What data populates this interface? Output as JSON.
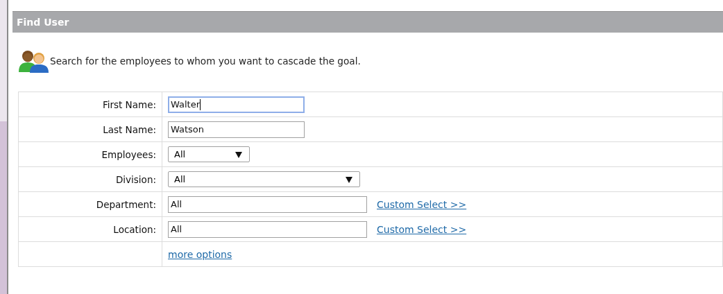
{
  "panel": {
    "title": "Find User"
  },
  "intro": "Search for the employees to whom you want to cascade the goal.",
  "fields": [
    {
      "kind": "text",
      "label": "First Name:",
      "value": "Walter",
      "focused": true
    },
    {
      "kind": "text",
      "label": "Last Name:",
      "value": "Watson",
      "focused": false
    },
    {
      "kind": "select",
      "label": "Employees:",
      "value": "All"
    },
    {
      "kind": "select",
      "label": "Division:",
      "value": "All"
    },
    {
      "kind": "text",
      "label": "Department:",
      "value": "All",
      "focused": false,
      "link": "Custom Select >>"
    },
    {
      "kind": "text",
      "label": "Location:",
      "value": "All",
      "focused": false,
      "link": "Custom Select >>"
    },
    {
      "kind": "link",
      "link": "more options"
    }
  ]
}
